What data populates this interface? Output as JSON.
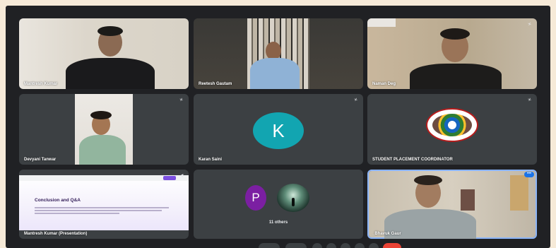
{
  "meeting": {
    "tiles": [
      {
        "name": "Mantresh Kumar"
      },
      {
        "name": "Reetesh Gautam"
      },
      {
        "name": "Naman Deg"
      },
      {
        "name": "Devyani Tanwar"
      },
      {
        "name": "Karan Saini",
        "avatar_letter": "K"
      },
      {
        "name": "STUDENT PLACEMENT COORDINATOR"
      },
      {
        "name": "Mantresh Kumar (Presentation)",
        "slide_title": "Conclusion and Q&A"
      },
      {
        "avatars": [
          "P"
        ],
        "others_label": "11 others"
      },
      {
        "name": "_Bhavuk Gaur"
      }
    ]
  },
  "colors": {
    "tile_bg": "#3c4043",
    "frame_bg": "#202124",
    "avatar_k": "#12a5b1",
    "avatar_p": "#7b1fa2",
    "active_border": "#8ab4f8",
    "end_call": "#ea4335"
  },
  "icons": [
    "mic-off-icon",
    "more-options-icon",
    "speaker-icon"
  ]
}
